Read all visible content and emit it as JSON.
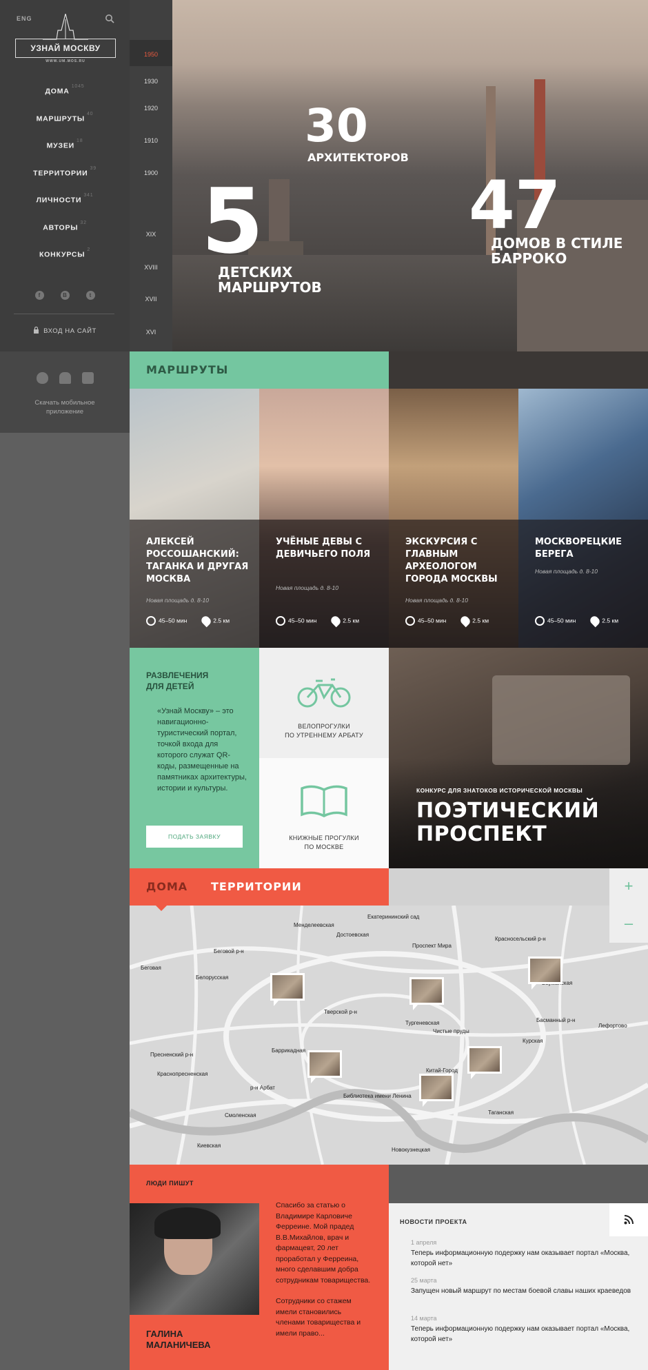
{
  "header": {
    "lang": "ENG"
  },
  "logo": {
    "title": "УЗНАЙ МОСКВУ",
    "subtitle": "WWW.UM.MOS.RU"
  },
  "nav": [
    {
      "label": "ДОМА",
      "count": "1045"
    },
    {
      "label": "МАРШРУТЫ",
      "count": "40"
    },
    {
      "label": "МУЗЕИ",
      "count": "18"
    },
    {
      "label": "ТЕРРИТОРИИ",
      "count": "39"
    },
    {
      "label": "ЛИЧНОСТИ",
      "count": "341"
    },
    {
      "label": "АВТОРЫ",
      "count": "32"
    },
    {
      "label": "КОНКУРСЫ",
      "count": "2"
    }
  ],
  "social": [
    "f",
    "В",
    "t"
  ],
  "login": "ВХОД НА САЙТ",
  "apps": {
    "text1": "Скачать мобильное",
    "text2": "приложение"
  },
  "years": [
    "1950",
    "1930",
    "1920",
    "1910",
    "1900",
    "XIX",
    "XVIII",
    "XVII",
    "XVI"
  ],
  "hero": {
    "stat1": {
      "num": "30",
      "label": "АРХИТЕКТОРОВ"
    },
    "stat2": {
      "num": "5",
      "label1": "ДЕТСКИХ",
      "label2": "МАРШРУТОВ"
    },
    "stat3": {
      "num": "47",
      "label1": "ДОМОВ  В СТИЛЕ",
      "label2": "БАРРОКО"
    }
  },
  "routes": {
    "title": "МАРШРУТЫ",
    "cards": [
      {
        "title": "АЛЕКСЕЙ РОССОШАНСКИЙ: ТАГАНКА И ДРУГАЯ МОСКВА",
        "address": "Новая площадь д. 8-10",
        "time": "45–50 мин",
        "distance": "2.5 км"
      },
      {
        "title": "УЧЁНЫЕ ДЕВЫ С ДЕВИЧЬЕГО ПОЛЯ",
        "address": "Новая площадь д. 8-10",
        "time": "45–50 мин",
        "distance": "2.5 км"
      },
      {
        "title": "ЭКСКУРСИЯ С ГЛАВНЫМ АРХЕОЛОГОМ ГОРОДА МОСКВЫ",
        "address": "Новая площадь д. 8-10",
        "time": "45–50 мин",
        "distance": "2.5 км"
      },
      {
        "title": "МОСКВОРЕЦКИЕ БЕРЕГА",
        "address": "Новая площадь д. 8-10",
        "time": "45–50 мин",
        "distance": "2.5 км"
      }
    ]
  },
  "kids": {
    "title1": "РАЗВЛЕЧЕНИЯ",
    "title2": "ДЛЯ ДЕТЕЙ",
    "text": "«Узнай Москву» – это навигационно-туристический портал, точкой входа для которого служат QR-коды, размещенные на памятниках архитектуры, истории и культуры.",
    "button": "ПОДАТЬ ЗАЯВКУ"
  },
  "bike": {
    "line1": "ВЕЛОПРОГУЛКИ",
    "line2": "ПО УТРЕННЕМУ АРБАТУ"
  },
  "books": {
    "line1": "КНИЖНЫЕ ПРОГУЛКИ",
    "line2": "ПО МОСКВЕ"
  },
  "contest": {
    "subtitle": "КОНКУРС ДЛЯ ЗНАТОКОВ ИСТОРИЧЕСКОЙ МОСКВЫ",
    "title1": "ПОЭТИЧЕСКИЙ",
    "title2": "ПРОСПЕКТ"
  },
  "map": {
    "tab1": "ДОМА",
    "tab2": "ТЕРРИТОРИИ",
    "zoom_in": "+",
    "zoom_out": "–",
    "labels": [
      "Беговой р-н",
      "Пресненский р-н",
      "Тверской р-н",
      "р-н Арбат",
      "Басманный р-н",
      "Лефортово",
      "Бауманская",
      "Менделеевская",
      "Достоевская",
      "Екатерининский сад",
      "Красносельский р-н",
      "Проспект Мира",
      "Курская",
      "Таганская",
      "Новокузнецкая",
      "Тургеневская",
      "Чистые пруды",
      "Китай-Город",
      "Библиотека имени Ленина",
      "Смоленская",
      "Киевская",
      "Баррикадная",
      "Краснопресненская",
      "Беговая",
      "Белорусская"
    ]
  },
  "people": {
    "title": "ЛЮДИ ПИШУТ",
    "name1": "ГАЛИНА",
    "name2": "МАЛАНИЧЕВА",
    "quote1": "Спасибо за статью о Владимире Карловиче Ферреине. Мой прадед В.В.Михайлов, врач и фармацевт, 20 лет проработал у Ферреина, много сделавшим добра сотрудникам товарищества.",
    "quote2": "Сотрудники со стажем имели становились членами товарищества и имели право..."
  },
  "news": {
    "title": "НОВОСТИ ПРОЕКТА",
    "items": [
      {
        "date": "1 апреля",
        "text": "Теперь информационную подержку нам оказывает портал «Москва, которой нет»"
      },
      {
        "date": "25 марта",
        "text": "Запущен новый маршрут по местам боевой славы наших краеведов"
      },
      {
        "date": "14 марта",
        "text": "Теперь информационную подержку нам оказывает портал «Москва, которой нет»"
      }
    ]
  },
  "colors": {
    "green": "#74c6a0",
    "red": "#f05a44",
    "dark": "#3d3d3d"
  }
}
